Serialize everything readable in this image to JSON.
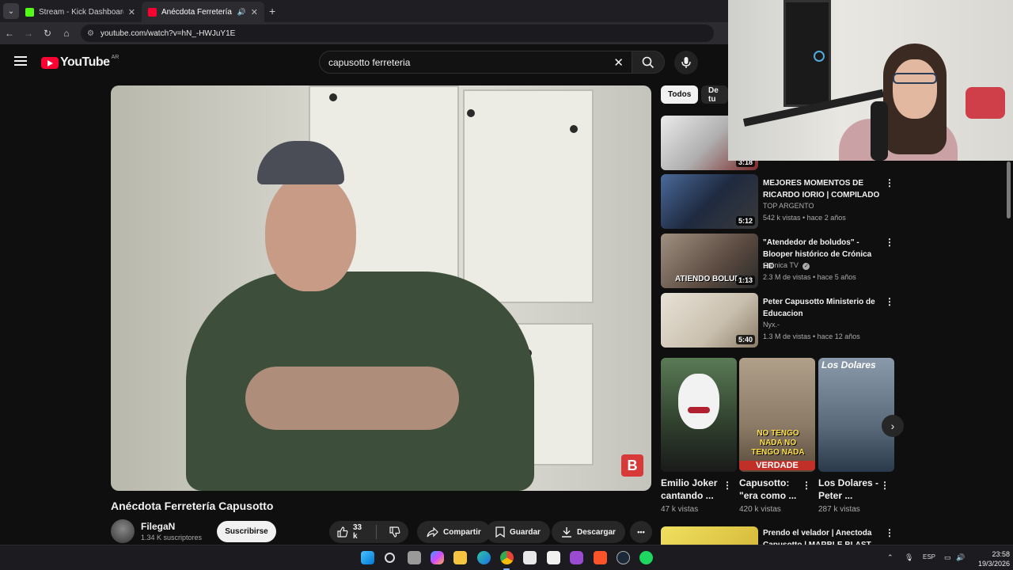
{
  "browser": {
    "tabs": [
      {
        "title": "Stream - Kick Dashboard",
        "active": false,
        "favicon_color": "#53fc18"
      },
      {
        "title": "Anécdota Ferretería Capusotto",
        "active": true,
        "favicon_color": "#ff0033"
      }
    ],
    "new_tab": "+",
    "url": "youtube.com/watch?v=hN_-HWJuY1E"
  },
  "youtube": {
    "logo_text": "YouTube",
    "country_code": "AR",
    "search_value": "capusotto ferreteria",
    "accent_color": "#ff0033"
  },
  "video": {
    "title": "Anécdota Ferretería Capusotto",
    "overlay_badge": "B",
    "channel_name": "FilegaN",
    "channel_subs": "1.34 K suscriptores",
    "subscribe_label": "Suscribirse",
    "likes": "33 k",
    "share_label": "Compartir",
    "save_label": "Guardar",
    "download_label": "Descargar",
    "more_label": "•••"
  },
  "sidebar": {
    "chips": [
      "Todos",
      "De tu"
    ],
    "recommendations": [
      {
        "title": "",
        "channel": "",
        "meta": "",
        "duration": "3:18",
        "thumb_color": "#7a2a2a"
      },
      {
        "title": "MEJORES MOMENTOS DE RICARDO IORIO | COMPILADO",
        "channel": "TOP ARGENTO",
        "meta": "542 k vistas • hace 2 años",
        "duration": "5:12",
        "thumb_color": "#2d3a55"
      },
      {
        "title": "\"Atendedor de boludos\" - Blooper histórico de Crónica HD",
        "channel": "Crónica TV",
        "meta": "2.3 M de vistas • hace 5 años",
        "duration": "1:13",
        "thumb_color": "#5b4a40",
        "thumb_caption": "ATIENDO BOLUDOS"
      },
      {
        "title": "Peter Capusotto  Ministerio de Educacion",
        "channel": "Nyx.-",
        "meta": "1.3 M de vistas • hace 12 años",
        "duration": "5:40",
        "thumb_color": "#c9bfae"
      },
      {
        "title": "Prendo el velador | Anectoda Capusotto | MARBLE BLAST",
        "channel": "",
        "meta": "",
        "duration": "",
        "thumb_color": "#e8d040"
      }
    ],
    "shorts": [
      {
        "title": "Emilio Joker cantando ...",
        "views": "47 k vistas",
        "thumb_color": "#3c5a3a"
      },
      {
        "title": "Capusotto: \"era como ...",
        "views": "420 k vistas",
        "thumb_color": "#8a7a66",
        "caption": "NO TENGO NADA NO TENGO NADA",
        "caption2": "VERDADE"
      },
      {
        "title": "Los Dolares - Peter ...",
        "views": "287 k vistas",
        "thumb_color": "#5a6a7a",
        "caption": "Los Dolares"
      }
    ]
  },
  "taskbar": {
    "language": "ESP",
    "time": "23:58",
    "date": "19/3/2026",
    "icons": [
      "windows-start",
      "search",
      "task-view",
      "copilot",
      "file-explorer",
      "edge",
      "chrome",
      "store",
      "capcut",
      "obs",
      "brave",
      "steam",
      "spotify"
    ]
  }
}
